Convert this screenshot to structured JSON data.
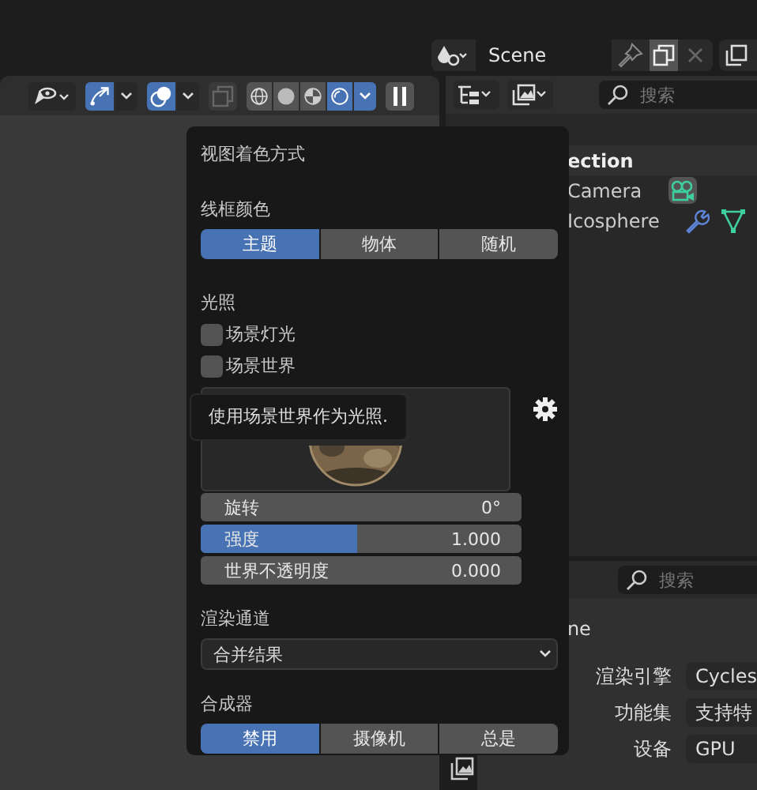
{
  "scene_selector": {
    "name": "Scene"
  },
  "viewport_header": {
    "gizmo_on": true,
    "overlay_on": true,
    "xray_on": false,
    "shading_modes": [
      {
        "selected": false
      },
      {
        "selected": false
      },
      {
        "selected": false
      },
      {
        "selected": true
      }
    ],
    "paused": false
  },
  "outliner": {
    "search": {
      "placeholder": "搜索"
    },
    "rows": [
      {
        "label": "ection",
        "kind": "collection"
      },
      {
        "label": "Camera",
        "kind": "camera"
      },
      {
        "label": "Icosphere",
        "kind": "mesh"
      }
    ]
  },
  "properties": {
    "search": {
      "placeholder": "搜索"
    },
    "header_text": "ne",
    "fields": [
      {
        "label": "渲染引擎",
        "value": "Cycles"
      },
      {
        "label": "功能集",
        "value": "支持特"
      },
      {
        "label": "设备",
        "value": "GPU"
      }
    ]
  },
  "popup": {
    "title": "视图着色方式",
    "wireframe": {
      "label": "线框颜色",
      "options": [
        {
          "label": "主题",
          "selected": true
        },
        {
          "label": "物体",
          "selected": false
        },
        {
          "label": "随机",
          "selected": false
        }
      ]
    },
    "lighting": {
      "label": "光照",
      "checkboxes": [
        {
          "label": "场景灯光",
          "checked": false
        },
        {
          "label": "场景世界",
          "checked": false
        }
      ],
      "sliders": [
        {
          "label": "旋转",
          "value": "0°",
          "kind": "number"
        },
        {
          "label": "强度",
          "value": "1.000",
          "kind": "slider",
          "level": 0.49
        },
        {
          "label": "世界不透明度",
          "value": "0.000",
          "kind": "number"
        }
      ]
    },
    "render_pass": {
      "label": "渲染通道",
      "value": "合并结果"
    },
    "compositor": {
      "label": "合成器",
      "options": [
        {
          "label": "禁用",
          "selected": true
        },
        {
          "label": "摄像机",
          "selected": false
        },
        {
          "label": "总是",
          "selected": false
        }
      ]
    }
  },
  "tooltip": {
    "text": "使用场景世界作为光照."
  }
}
